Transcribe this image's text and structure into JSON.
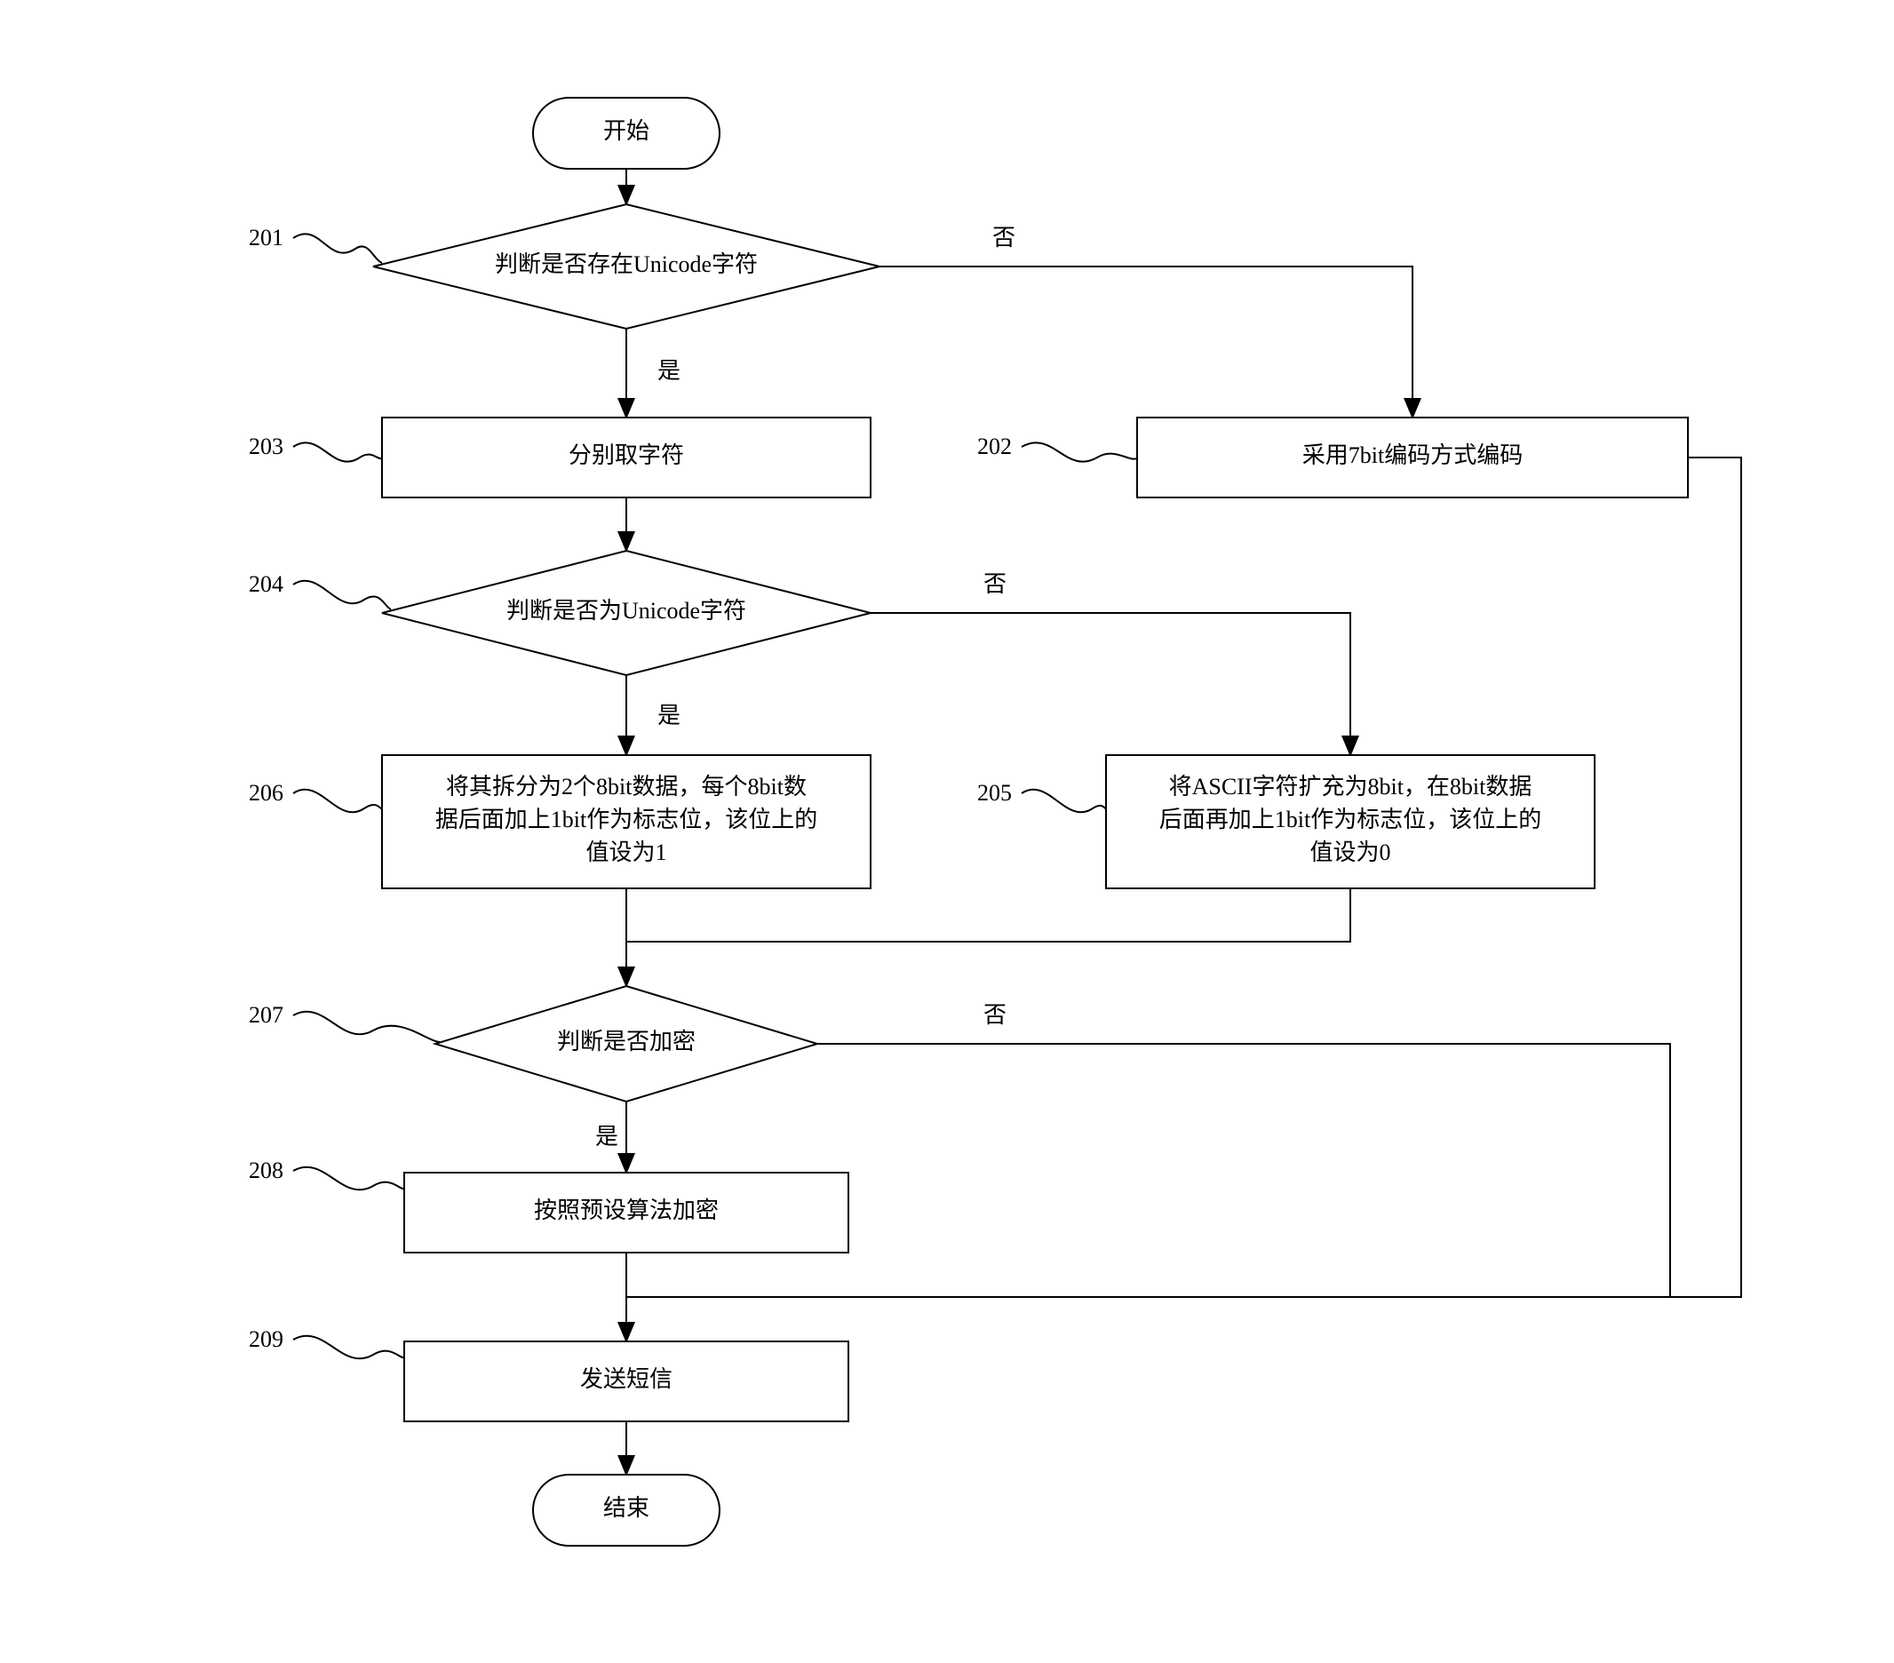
{
  "flow": {
    "start": "开始",
    "end": "结束",
    "d1": "判断是否存在Unicode字符",
    "d2": "判断是否为Unicode字符",
    "d3": "判断是否加密",
    "p202": "采用7bit编码方式编码",
    "p203": "分别取字符",
    "p205_l1": "将ASCII字符扩充为8bit，在8bit数据",
    "p205_l2": "后面再加上1bit作为标志位，该位上的",
    "p205_l3": "值设为0",
    "p206_l1": "将其拆分为2个8bit数据，每个8bit数",
    "p206_l2": "据后面加上1bit作为标志位，该位上的",
    "p206_l3": "值设为1",
    "p208": "按照预设算法加密",
    "p209": "发送短信",
    "yes": "是",
    "no": "否"
  },
  "labels": {
    "n201": "201",
    "n202": "202",
    "n203": "203",
    "n204": "204",
    "n205": "205",
    "n206": "206",
    "n207": "207",
    "n208": "208",
    "n209": "209"
  }
}
